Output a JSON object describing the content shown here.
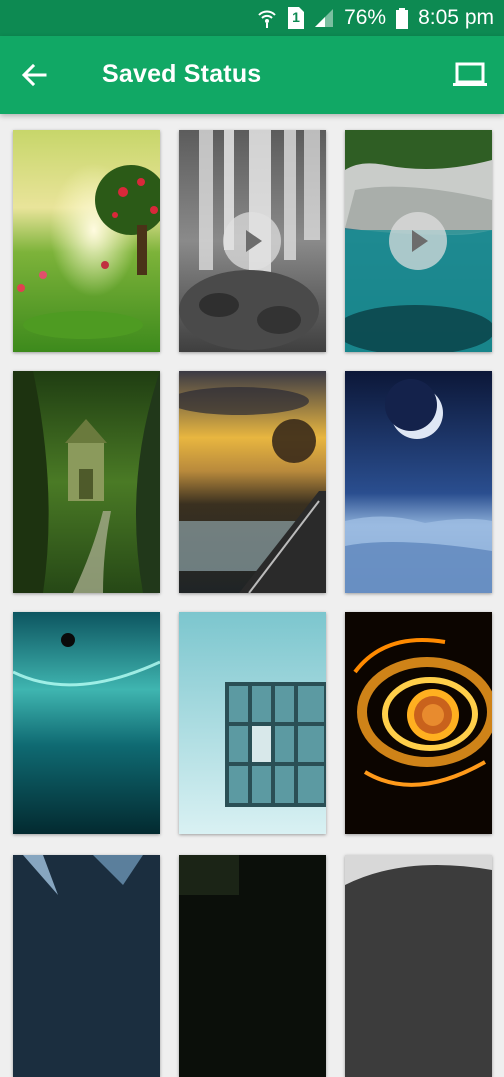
{
  "status_bar": {
    "battery_percent": "76%",
    "time": "8:05 pm",
    "sim_label": "1",
    "icons": [
      "wifi-hotspot-icon",
      "sim-icon",
      "signal-icon",
      "battery-icon"
    ]
  },
  "app_bar": {
    "title": "Saved Status",
    "back_icon": "arrow-left-icon",
    "action_icon": "laptop-icon",
    "color": "#11a865",
    "status_color": "#0d8a52"
  },
  "grid": {
    "items": [
      {
        "name": "fantasy-tree-meadow",
        "type": "image"
      },
      {
        "name": "waterfall-rocks",
        "type": "video"
      },
      {
        "name": "coastal-cliffs-lagoon",
        "type": "video"
      },
      {
        "name": "forest-tree-house",
        "type": "image"
      },
      {
        "name": "sunset-bridge-river",
        "type": "image"
      },
      {
        "name": "crescent-moon-snow",
        "type": "image"
      },
      {
        "name": "teal-space-planet",
        "type": "image"
      },
      {
        "name": "cube-3d",
        "type": "image"
      },
      {
        "name": "fire-eye-swirl",
        "type": "image"
      },
      {
        "name": "partial-dark-blue",
        "type": "image"
      },
      {
        "name": "partial-dark",
        "type": "image"
      },
      {
        "name": "partial-gray",
        "type": "image"
      }
    ]
  }
}
